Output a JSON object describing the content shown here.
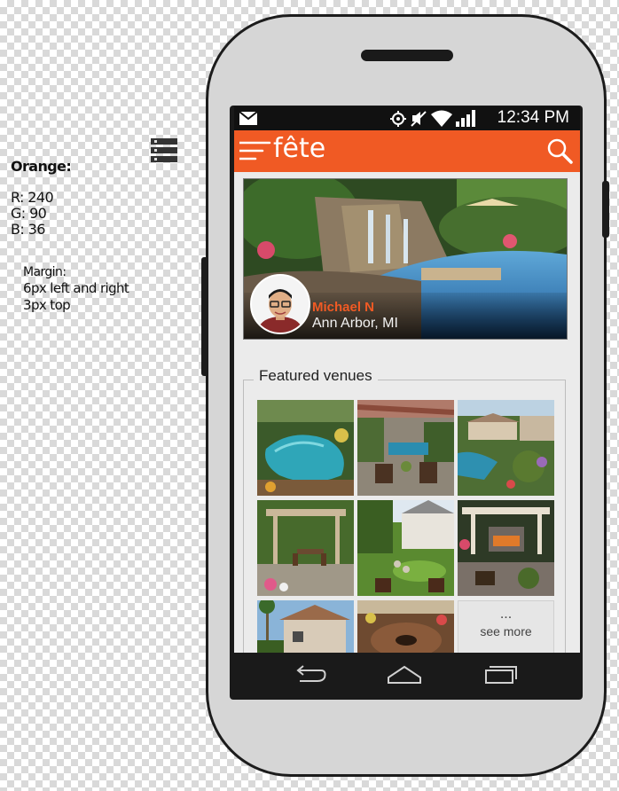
{
  "annotations": {
    "color_heading": "Orange:",
    "r": "R: 240",
    "g": "G: 90",
    "b": "B: 36",
    "margin_heading": "Margin:",
    "margin_lr": "6px left and right",
    "margin_top": "3px top",
    "accent_hex": "#f05a24"
  },
  "statusbar": {
    "time": "12:34 PM",
    "icons": [
      "mail-icon",
      "location-icon",
      "mute-icon",
      "wifi-icon",
      "signal-icon"
    ]
  },
  "appbar": {
    "title": "fête",
    "menu_icon": "hamburger-icon",
    "search_icon": "search-icon"
  },
  "profile": {
    "name": "Michael N",
    "location": "Ann Arbor, MI"
  },
  "venues": {
    "heading": "Featured venues",
    "see_more_dots": "...",
    "see_more_label": "see more"
  },
  "navbar": {
    "icons": [
      "back-icon",
      "home-icon",
      "recent-apps-icon"
    ]
  }
}
